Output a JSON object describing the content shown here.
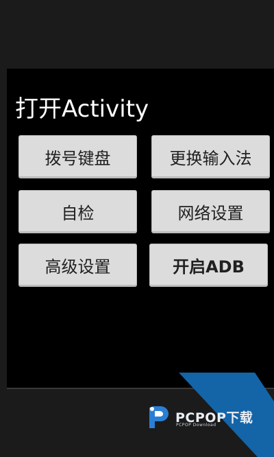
{
  "screen": {
    "title": "打开Activity"
  },
  "buttons": [
    {
      "label": "拨号键盘"
    },
    {
      "label": "更换输入法"
    },
    {
      "label": "自检"
    },
    {
      "label": "网络设置"
    },
    {
      "label": "高级设置"
    },
    {
      "label": "开启ADB"
    }
  ],
  "watermark": {
    "brand": "PCPOP下载",
    "subtitle": "PCPOP Download",
    "icon": "pcpop-logo-icon",
    "colors": {
      "triangle": "#1464a8",
      "logo": "#2a7fd4"
    }
  },
  "theme": {
    "background": "#1b1b1b",
    "panel": "#000000",
    "button_bg": "#dcdcdc",
    "button_text": "#202020",
    "title_text": "#ffffff"
  }
}
